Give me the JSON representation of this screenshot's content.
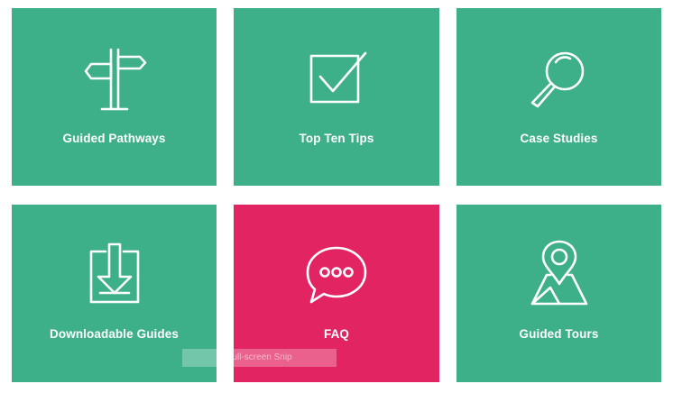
{
  "colors": {
    "tile_green": "#3eb089",
    "tile_pink": "#e32463",
    "icon_stroke": "#ffffff",
    "background": "#ffffff"
  },
  "tiles": [
    {
      "label": "Guided Pathways",
      "icon": "signpost-icon",
      "color": "#3eb089"
    },
    {
      "label": "Top Ten Tips",
      "icon": "checkbox-icon",
      "color": "#3eb089"
    },
    {
      "label": "Case Studies",
      "icon": "magnifier-icon",
      "color": "#3eb089"
    },
    {
      "label": "Downloadable Guides",
      "icon": "download-tray-icon",
      "color": "#3eb089"
    },
    {
      "label": "FAQ",
      "icon": "speech-bubble-icon",
      "color": "#e32463"
    },
    {
      "label": "Guided Tours",
      "icon": "map-pin-icon",
      "color": "#3eb089"
    }
  ],
  "overlay": {
    "text": "Full-screen Snip"
  }
}
